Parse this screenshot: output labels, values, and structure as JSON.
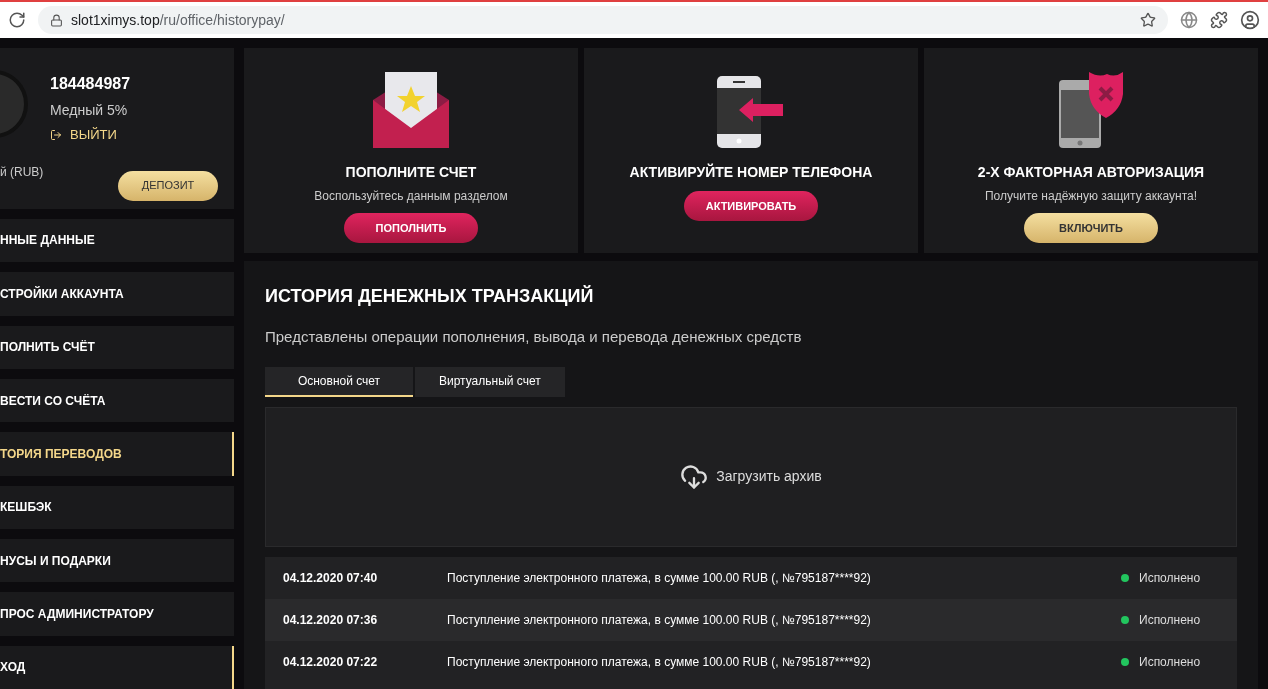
{
  "browser": {
    "url_host": "slot1ximys.top",
    "url_path": "/ru/office/historypay/"
  },
  "profile": {
    "id": "184484987",
    "level": "Медный 5%",
    "logout": "ВЫЙТИ",
    "balance_label": "й (RUB)",
    "deposit": "ДЕПОЗИТ"
  },
  "sidebar": {
    "items": [
      {
        "label": "ННЫЕ ДАННЫЕ",
        "selected": false,
        "hovered": false
      },
      {
        "label": "СТРОЙКИ АККАУНТА",
        "selected": false,
        "hovered": false
      },
      {
        "label": "ПОЛНИТЬ СЧЁТ",
        "selected": false,
        "hovered": false
      },
      {
        "label": "ВЕСТИ СО СЧЁТА",
        "selected": false,
        "hovered": false
      },
      {
        "label": "ТОРИЯ ПЕРЕВОДОВ",
        "selected": true,
        "hovered": false
      },
      {
        "label": "КЕШБЭК",
        "selected": false,
        "hovered": false
      },
      {
        "label": "НУСЫ И ПОДАРКИ",
        "selected": false,
        "hovered": false
      },
      {
        "label": "ПРОС АДМИНИСТРАТОРУ",
        "selected": false,
        "hovered": false
      },
      {
        "label": "ХОД",
        "selected": false,
        "hovered": true
      }
    ]
  },
  "promo_cards": [
    {
      "kind": "envelope",
      "title": "ПОПОЛНИТЕ СЧЕТ",
      "subtitle": "Воспользуйтесь данным разделом",
      "button": "ПОПОЛНИТЬ",
      "button_gold": false
    },
    {
      "kind": "phone",
      "title": "АКТИВИРУЙТЕ НОМЕР ТЕЛЕФОНА",
      "button": "АКТИВИРОВАТЬ",
      "button_gold": false
    },
    {
      "kind": "shield",
      "title": "2-Х ФАКТОРНАЯ АВТОРИЗАЦИЯ",
      "subtitle": "Получите надёжную защиту аккаунта!",
      "button": "ВКЛЮЧИТЬ",
      "button_gold": true
    }
  ],
  "history": {
    "title": "ИСТОРИЯ ДЕНЕЖНЫХ ТРАНЗАКЦИЙ",
    "subtitle": "Представлены операции пополнения, вывода и перевода денежных средств",
    "tabs": [
      {
        "label": "Основной счет",
        "selected": true
      },
      {
        "label": "Виртуальный счет",
        "selected": false
      }
    ],
    "archive": "Загрузить архив",
    "rows": [
      {
        "date": "04.12.2020 07:40",
        "description": "Поступление электронного платежа, в сумме 100.00 RUB (, №795187****92)",
        "status": "Исполнено",
        "color": "#22c55e"
      },
      {
        "date": "04.12.2020 07:36",
        "description": "Поступление электронного платежа, в сумме 100.00 RUB (, №795187****92)",
        "status": "Исполнено",
        "color": "#22c55e"
      },
      {
        "date": "04.12.2020 07:22",
        "description": "Поступление электронного платежа, в сумме 100.00 RUB (, №795187****92)",
        "status": "Исполнено",
        "color": "#22c55e"
      }
    ]
  }
}
